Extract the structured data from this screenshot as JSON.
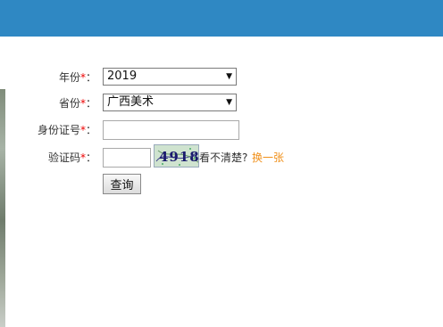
{
  "form": {
    "year": {
      "label": "年份",
      "required_mark": "*",
      "colon": "：",
      "value": "2019"
    },
    "province": {
      "label": "省份",
      "required_mark": "*",
      "colon": "：",
      "value": "广西美术"
    },
    "id_number": {
      "label": "身份证号",
      "required_mark": "*",
      "colon": "：",
      "value": ""
    },
    "captcha": {
      "label": "验证码",
      "required_mark": "*",
      "colon": "：",
      "value": "",
      "image_text": "4918",
      "unclear_text": "看不清楚?",
      "refresh_text": "换一张"
    },
    "submit_label": "查询"
  },
  "colors": {
    "topbar": "#2f88c3",
    "required": "#e00000",
    "refresh_link": "#f0901b"
  },
  "icons": {
    "dropdown": "chevron-down-icon"
  }
}
